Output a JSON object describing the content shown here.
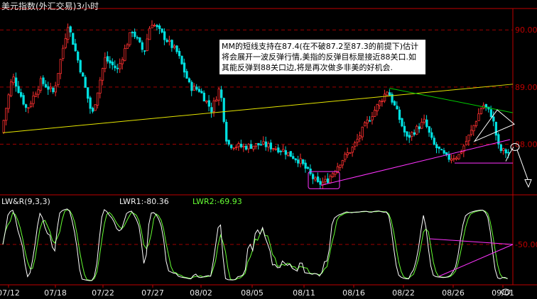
{
  "window": {
    "title": "美元指数(外汇交易)3小时"
  },
  "annotation": {
    "text": "MM的短线支持在87.4(在不破87.2至87.3的前提下)估计将会展开一波反弹行情,美指的反弹目标是接近88关口.如其能反弹到88关口边,将是再次做多非美的好机会."
  },
  "indicator": {
    "name": "LW&R(9,3,3)",
    "lwr1_label": "LWR1:-80.36",
    "lwr2_label": "LWR2:-69.93"
  },
  "colors": {
    "up": "#ff3030",
    "down": "#00e0e0",
    "grid": "#a00000",
    "axis": "#c00000",
    "support": "#e6e600",
    "wedge": "#ff33ff",
    "wedge_top": "#00cc00",
    "lwr1": "#ffffff",
    "lwr2": "#66ff33"
  },
  "chart_data": [
    {
      "type": "candlestick",
      "title": "美元指数(外汇交易)3小时",
      "price_range": [
        87.15,
        90.35
      ],
      "y_ticks": [
        90.0,
        89.0,
        88.0
      ],
      "x_ticks": [
        "07/12",
        "07/18",
        "07/22",
        "07/27",
        "08/02",
        "08/05",
        "08/11",
        "08/16",
        "08/22",
        "08/26",
        "09/01"
      ],
      "candles": 205,
      "series_summary": {
        "start": 88.2,
        "high_1": 90.1,
        "high_2": 90.15,
        "low": 87.3,
        "mid_high": 89.0,
        "recent_high": 88.7,
        "last": 87.85
      }
    },
    {
      "type": "line",
      "name": "LW&R(9,3,3)",
      "ylim": [
        -100,
        0
      ],
      "y_ticks": [
        -50
      ],
      "series": [
        {
          "name": "LWR1",
          "last": -80.36
        },
        {
          "name": "LWR2",
          "last": -69.93
        }
      ]
    }
  ]
}
